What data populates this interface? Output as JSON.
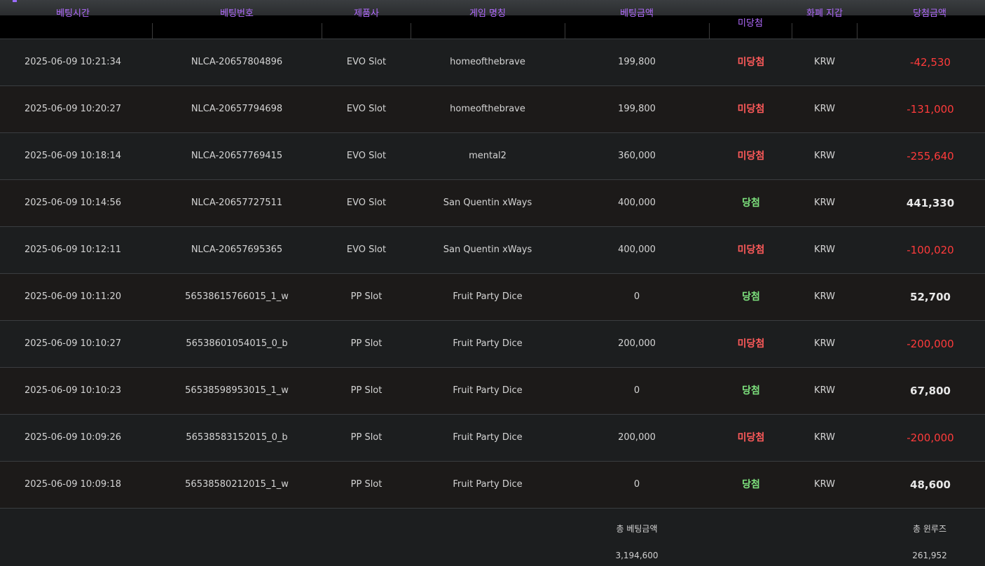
{
  "colors": {
    "header_text": "#b26bff",
    "lose": "#ff5a5a",
    "win": "#7ee37e",
    "negative_amount": "#ff3b3b"
  },
  "header": {
    "bet_time": "베팅시간",
    "bet_no": "베팅번호",
    "provider": "제품사",
    "game_name": "게임 명칭",
    "bet_amount": "베팅금액",
    "result": "미당첨",
    "currency": "화폐 지갑",
    "win_amount": "당첨금액"
  },
  "rows": [
    {
      "time": "2025-06-09 10:21:34",
      "no": "NLCA-20657804896",
      "provider": "EVO Slot",
      "game": "homeofthebrave",
      "bet": "199,800",
      "result": "미당첨",
      "currency": "KRW",
      "win": "-42,530"
    },
    {
      "time": "2025-06-09 10:20:27",
      "no": "NLCA-20657794698",
      "provider": "EVO Slot",
      "game": "homeofthebrave",
      "bet": "199,800",
      "result": "미당첨",
      "currency": "KRW",
      "win": "-131,000"
    },
    {
      "time": "2025-06-09 10:18:14",
      "no": "NLCA-20657769415",
      "provider": "EVO Slot",
      "game": "mental2",
      "bet": "360,000",
      "result": "미당첨",
      "currency": "KRW",
      "win": "-255,640"
    },
    {
      "time": "2025-06-09 10:14:56",
      "no": "NLCA-20657727511",
      "provider": "EVO Slot",
      "game": "San Quentin xWays",
      "bet": "400,000",
      "result": "당첨",
      "currency": "KRW",
      "win": "441,330"
    },
    {
      "time": "2025-06-09 10:12:11",
      "no": "NLCA-20657695365",
      "provider": "EVO Slot",
      "game": "San Quentin xWays",
      "bet": "400,000",
      "result": "미당첨",
      "currency": "KRW",
      "win": "-100,020"
    },
    {
      "time": "2025-06-09 10:11:20",
      "no": "56538615766015_1_w",
      "provider": "PP Slot",
      "game": "Fruit Party Dice",
      "bet": "0",
      "result": "당첨",
      "currency": "KRW",
      "win": "52,700"
    },
    {
      "time": "2025-06-09 10:10:27",
      "no": "56538601054015_0_b",
      "provider": "PP Slot",
      "game": "Fruit Party Dice",
      "bet": "200,000",
      "result": "미당첨",
      "currency": "KRW",
      "win": "-200,000"
    },
    {
      "time": "2025-06-09 10:10:23",
      "no": "56538598953015_1_w",
      "provider": "PP Slot",
      "game": "Fruit Party Dice",
      "bet": "0",
      "result": "당첨",
      "currency": "KRW",
      "win": "67,800"
    },
    {
      "time": "2025-06-09 10:09:26",
      "no": "56538583152015_0_b",
      "provider": "PP Slot",
      "game": "Fruit Party Dice",
      "bet": "200,000",
      "result": "미당첨",
      "currency": "KRW",
      "win": "-200,000"
    },
    {
      "time": "2025-06-09 10:09:18",
      "no": "56538580212015_1_w",
      "provider": "PP Slot",
      "game": "Fruit Party Dice",
      "bet": "0",
      "result": "당첨",
      "currency": "KRW",
      "win": "48,600"
    }
  ],
  "footer": {
    "total_bet_label": "총 베팅금액",
    "total_bet_value": "3,194,600",
    "total_win_label": "총 윈루즈",
    "total_win_value": "261,952"
  }
}
